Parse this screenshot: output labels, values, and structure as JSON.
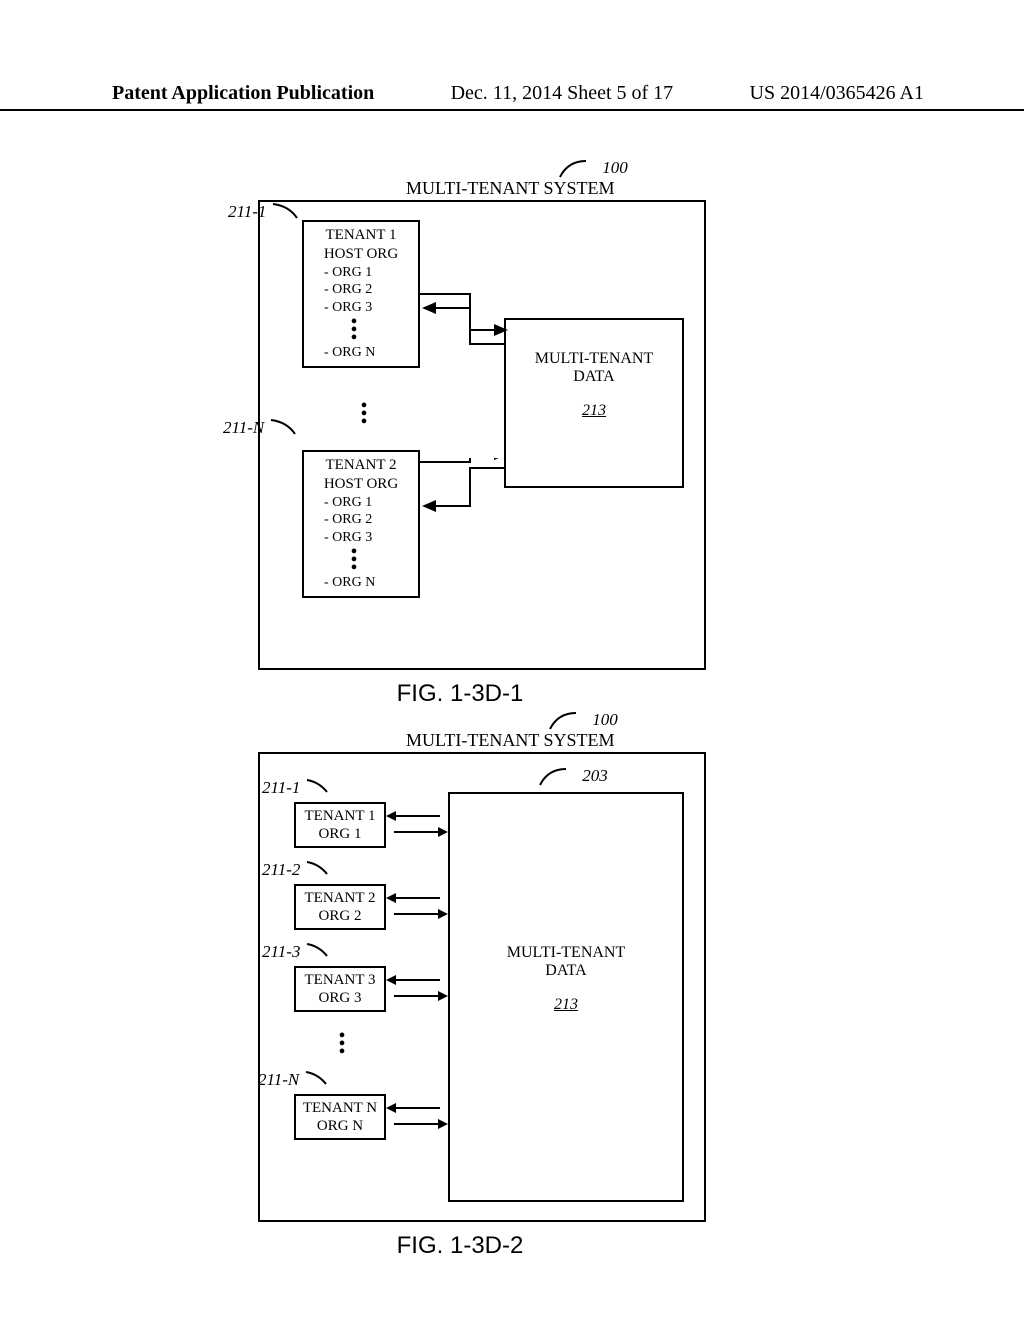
{
  "header": {
    "left": "Patent Application Publication",
    "mid": "Dec. 11, 2014  Sheet 5 of 17",
    "right": "US 2014/0365426 A1"
  },
  "fig1": {
    "caption": "FIG. 1-3D-1",
    "systemRef": "100",
    "systemTitle": "MULTI-TENANT SYSTEM",
    "tenantA": {
      "ref": "211-1",
      "name": "TENANT 1",
      "host": "HOST ORG",
      "orgs": [
        "- ORG 1",
        "- ORG 2",
        "- ORG 3"
      ],
      "orgN": "- ORG N"
    },
    "tenantB": {
      "ref": "211-N",
      "name": "TENANT 2",
      "host": "HOST ORG",
      "orgs": [
        "- ORG 1",
        "- ORG 2",
        "- ORG 3"
      ],
      "orgN": "- ORG N"
    },
    "data": {
      "title": "MULTI-TENANT DATA",
      "ref": "213"
    }
  },
  "fig2": {
    "caption": "FIG. 1-3D-2",
    "systemRef": "100",
    "systemTitle": "MULTI-TENANT SYSTEM",
    "dataRef": "203",
    "tenants": [
      {
        "ref": "211-1",
        "name": "TENANT 1",
        "org": "ORG 1"
      },
      {
        "ref": "211-2",
        "name": "TENANT 2",
        "org": "ORG 2"
      },
      {
        "ref": "211-3",
        "name": "TENANT 3",
        "org": "ORG 3"
      },
      {
        "ref": "211-N",
        "name": "TENANT N",
        "org": "ORG N"
      }
    ],
    "data": {
      "title": "MULTI-TENANT DATA",
      "ref": "213"
    }
  }
}
